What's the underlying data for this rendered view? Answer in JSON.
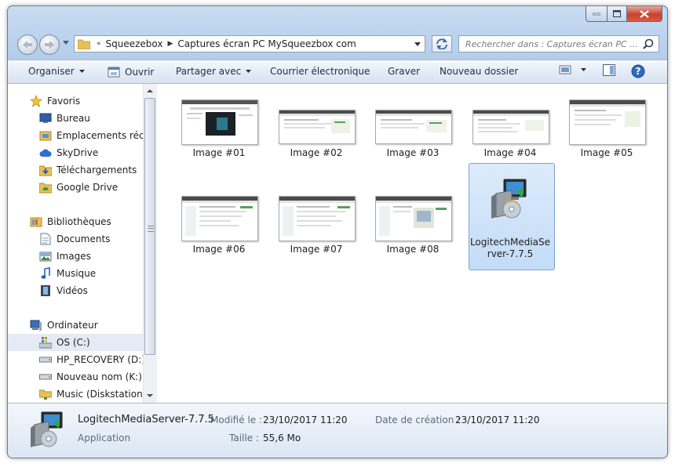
{
  "window": {
    "caption": {
      "minimize": "minimize",
      "maximize": "maximize",
      "close": "close"
    }
  },
  "address": {
    "overflow": "«",
    "crumbs": [
      "Squeezebox",
      "Captures écran PC MySqueezbox com"
    ]
  },
  "search": {
    "placeholder": "Rechercher dans : Captures écran PC ..."
  },
  "toolbar": {
    "organize": "Organiser",
    "open": "Ouvrir",
    "share": "Partager avec",
    "email": "Courrier électronique",
    "burn": "Graver",
    "new_folder": "Nouveau dossier"
  },
  "sidebar": {
    "favorites": {
      "label": "Favoris",
      "items": [
        "Bureau",
        "Emplacements récents",
        "SkyDrive",
        "Téléchargements",
        "Google Drive"
      ]
    },
    "libraries": {
      "label": "Bibliothèques",
      "items": [
        "Documents",
        "Images",
        "Musique",
        "Vidéos"
      ]
    },
    "computer": {
      "label": "Ordinateur",
      "items": [
        "OS (C:)",
        "HP_RECOVERY (D:)",
        "Nouveau nom (K:)",
        "Music (Diskstation)"
      ]
    }
  },
  "files": [
    {
      "name": "Image #01",
      "kind": "screenshot"
    },
    {
      "name": "Image #02",
      "kind": "screenshot"
    },
    {
      "name": "Image #03",
      "kind": "screenshot"
    },
    {
      "name": "Image #04",
      "kind": "screenshot"
    },
    {
      "name": "Image #05",
      "kind": "screenshot"
    },
    {
      "name": "Image #06",
      "kind": "screenshot"
    },
    {
      "name": "Image #07",
      "kind": "screenshot"
    },
    {
      "name": "Image #08",
      "kind": "screenshot"
    },
    {
      "name_line1": "LogitechMediaSe",
      "name_line2": "rver-7.7.5",
      "kind": "installer",
      "selected": true
    }
  ],
  "details": {
    "name": "LogitechMediaServer-7.7.5",
    "type": "Application",
    "modified_label": "Modifié le :",
    "modified_value": "23/10/2017 11:20",
    "size_label": "Taille :",
    "size_value": "55,6 Mo",
    "created_label": "Date de création :",
    "created_value": "23/10/2017 11:20"
  },
  "colors": {
    "selection": "#cce2fa",
    "toolbar_text": "#1e2f46",
    "close": "#c7412d"
  }
}
